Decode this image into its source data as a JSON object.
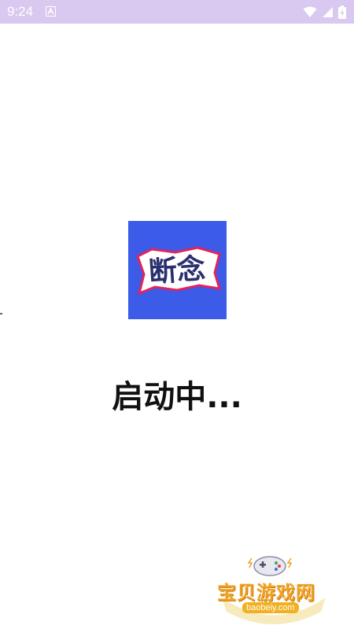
{
  "status_bar": {
    "time": "9:24",
    "notification_icon": "a-letter-icon",
    "wifi_icon": "wifi-icon",
    "signal_icon": "signal-icon",
    "battery_icon": "battery-charging-icon"
  },
  "splash": {
    "logo_text": "断念",
    "logo_bg_color": "#3c5be8",
    "loading_text": "启动中..."
  },
  "watermark": {
    "title": "宝贝游戏网",
    "url": "baobeiy.com",
    "icon": "gamepad-icon",
    "accent_color": "#f0a020"
  }
}
